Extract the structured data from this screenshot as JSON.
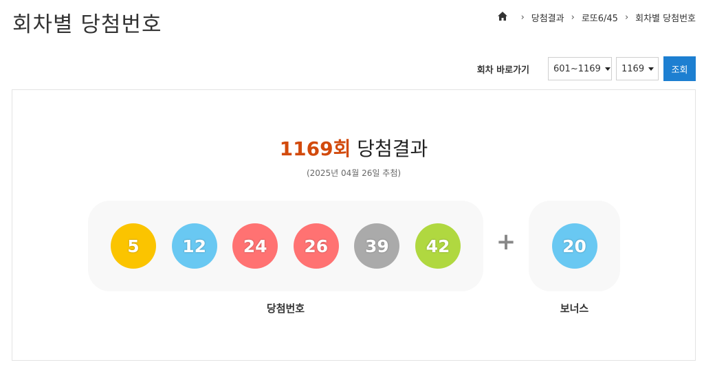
{
  "page": {
    "title": "회차별 당첨번호"
  },
  "breadcrumb": {
    "home_icon": "home-icon",
    "items": [
      "당첨결과",
      "로또6/45",
      "회차별 당첨번호"
    ]
  },
  "round_nav": {
    "label": "회차 바로가기",
    "range_selected": "601~1169",
    "round_selected": "1169",
    "search_label": "조회"
  },
  "result": {
    "round_number": "1169회",
    "heading_suffix": " 당첨결과",
    "draw_date": "(2025년 04월 26일 추첨)",
    "winning_numbers": [
      {
        "value": "5",
        "color": "#fbc400"
      },
      {
        "value": "12",
        "color": "#69c8f2"
      },
      {
        "value": "24",
        "color": "#ff7272"
      },
      {
        "value": "26",
        "color": "#ff7272"
      },
      {
        "value": "39",
        "color": "#aaaaaa"
      },
      {
        "value": "42",
        "color": "#b0d840"
      }
    ],
    "plus": "+",
    "bonus": {
      "value": "20",
      "color": "#69c8f2"
    },
    "winning_caption": "당첨번호",
    "bonus_caption": "보너스"
  }
}
